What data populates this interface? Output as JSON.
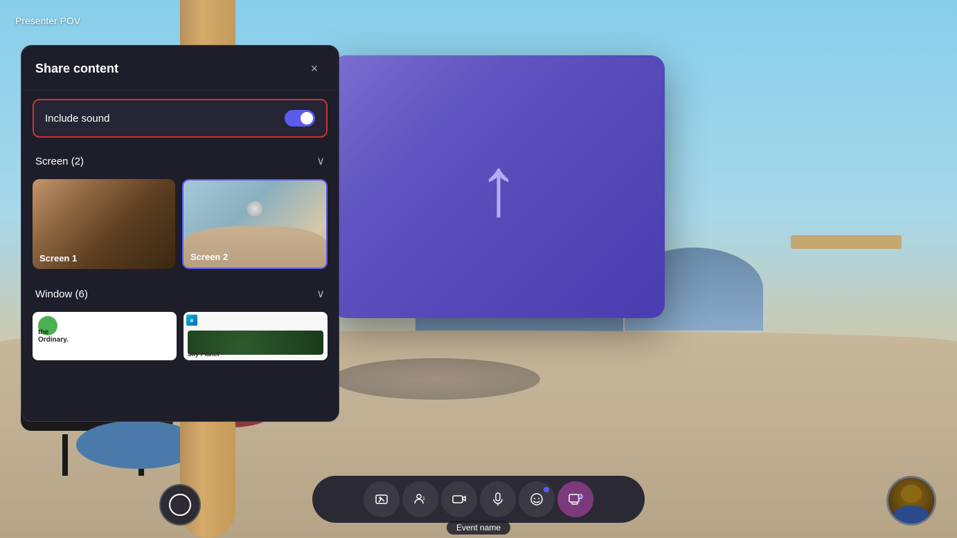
{
  "presenter_pov": {
    "label": "Presenter POV"
  },
  "share_panel": {
    "title": "Share content",
    "close_label": "×",
    "include_sound": {
      "label": "Include sound",
      "toggle_state": "on"
    },
    "screen_section": {
      "label": "Screen (2)",
      "expanded": true,
      "chevron": "∨",
      "screens": [
        {
          "id": "screen1",
          "label": "Screen 1"
        },
        {
          "id": "screen2",
          "label": "Screen 2"
        }
      ]
    },
    "window_section": {
      "label": "Window (6)",
      "expanded": true,
      "chevron": "∨",
      "windows": [
        {
          "id": "w1",
          "label": "The Ordinary"
        },
        {
          "id": "w2",
          "label": "Sky Planet"
        }
      ]
    }
  },
  "toolbar": {
    "buttons": [
      {
        "id": "avatar",
        "icon": "⊙",
        "label": "avatar-button"
      },
      {
        "id": "scenes",
        "icon": "🎬",
        "label": "scenes-button"
      },
      {
        "id": "participants",
        "icon": "👤1",
        "label": "participants-button"
      },
      {
        "id": "camera",
        "icon": "📷",
        "label": "camera-button"
      },
      {
        "id": "mic",
        "icon": "🎤",
        "label": "mic-button"
      },
      {
        "id": "reactions",
        "icon": "🙂",
        "label": "reactions-button"
      },
      {
        "id": "share",
        "icon": "⬆",
        "label": "share-button",
        "active": true
      }
    ],
    "event_name": "Event name"
  },
  "colors": {
    "accent_blue": "#5b5bf0",
    "panel_bg": "#1e1e2a",
    "toggle_on": "#5b5bf0",
    "share_active": "#7b3b7b",
    "red_border": "#cc3333"
  }
}
